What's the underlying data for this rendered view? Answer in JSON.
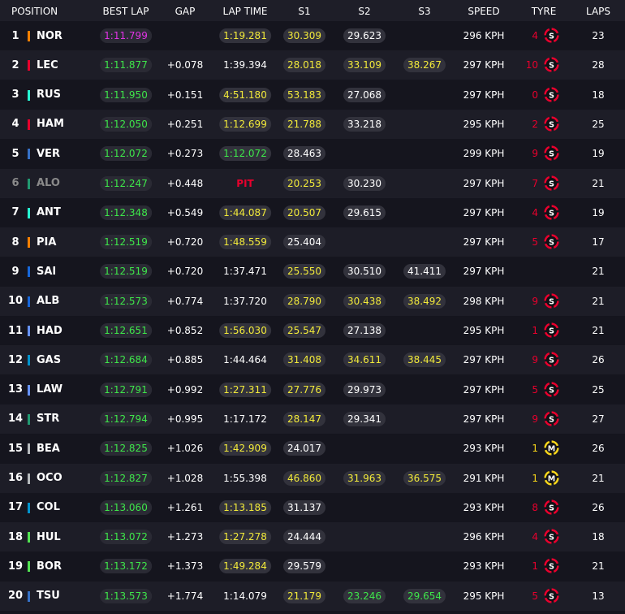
{
  "header": {
    "position": "POSITION",
    "best_lap": "BEST LAP",
    "gap": "GAP",
    "lap_time": "LAP TIME",
    "s1": "S1",
    "s2": "S2",
    "s3": "S3",
    "speed": "SPEED",
    "tyre": "TYRE",
    "laps": "LAPS"
  },
  "colors": {
    "purple": "#e233e6",
    "green": "#3ee64a",
    "yellow": "#f2ea3a",
    "white": "#ffffff",
    "red": "#e8002d",
    "soft": "#e8002d",
    "medium": "#f5d41a"
  },
  "rows": [
    {
      "pos": "1",
      "code": "NOR",
      "team": "#ff8000",
      "best": "1:11.799",
      "best_color": "purple",
      "gap": "",
      "lap": "1:19.281",
      "lap_color": "yellow",
      "s1": "30.309",
      "s1_color": "yellow",
      "s2": "29.623",
      "s2_color": "white",
      "s3": "",
      "s3_color": "white",
      "speed": "296 KPH",
      "tyre_age": "4",
      "tyre": "S",
      "laps": "23",
      "dim": false
    },
    {
      "pos": "2",
      "code": "LEC",
      "team": "#e8002d",
      "best": "1:11.877",
      "best_color": "green",
      "gap": "+0.078",
      "lap": "1:39.394",
      "lap_color": "white",
      "s1": "28.018",
      "s1_color": "yellow",
      "s2": "33.109",
      "s2_color": "yellow",
      "s3": "38.267",
      "s3_color": "yellow",
      "speed": "297 KPH",
      "tyre_age": "10",
      "tyre": "S",
      "laps": "28",
      "dim": false
    },
    {
      "pos": "3",
      "code": "RUS",
      "team": "#27f4d2",
      "best": "1:11.950",
      "best_color": "green",
      "gap": "+0.151",
      "lap": "4:51.180",
      "lap_color": "yellow",
      "s1": "53.183",
      "s1_color": "yellow",
      "s2": "27.068",
      "s2_color": "white",
      "s3": "",
      "s3_color": "white",
      "speed": "297 KPH",
      "tyre_age": "0",
      "tyre": "S",
      "laps": "18",
      "dim": false
    },
    {
      "pos": "4",
      "code": "HAM",
      "team": "#e8002d",
      "best": "1:12.050",
      "best_color": "green",
      "gap": "+0.251",
      "lap": "1:12.699",
      "lap_color": "yellow",
      "s1": "21.788",
      "s1_color": "yellow",
      "s2": "33.218",
      "s2_color": "white",
      "s3": "",
      "s3_color": "white",
      "speed": "295 KPH",
      "tyre_age": "2",
      "tyre": "S",
      "laps": "25",
      "dim": false
    },
    {
      "pos": "5",
      "code": "VER",
      "team": "#3671c6",
      "best": "1:12.072",
      "best_color": "green",
      "gap": "+0.273",
      "lap": "1:12.072",
      "lap_color": "green",
      "s1": "28.463",
      "s1_color": "white",
      "s2": "",
      "s2_color": "white",
      "s3": "",
      "s3_color": "white",
      "speed": "299 KPH",
      "tyre_age": "9",
      "tyre": "S",
      "laps": "19",
      "dim": false
    },
    {
      "pos": "6",
      "code": "ALO",
      "team": "#229971",
      "best": "1:12.247",
      "best_color": "green",
      "gap": "+0.448",
      "lap": "PIT",
      "lap_color": "red",
      "s1": "20.253",
      "s1_color": "yellow",
      "s2": "30.230",
      "s2_color": "white",
      "s3": "",
      "s3_color": "white",
      "speed": "297 KPH",
      "tyre_age": "7",
      "tyre": "S",
      "laps": "21",
      "dim": true
    },
    {
      "pos": "7",
      "code": "ANT",
      "team": "#27f4d2",
      "best": "1:12.348",
      "best_color": "green",
      "gap": "+0.549",
      "lap": "1:44.087",
      "lap_color": "yellow",
      "s1": "20.507",
      "s1_color": "yellow",
      "s2": "29.615",
      "s2_color": "white",
      "s3": "",
      "s3_color": "white",
      "speed": "297 KPH",
      "tyre_age": "4",
      "tyre": "S",
      "laps": "19",
      "dim": false
    },
    {
      "pos": "8",
      "code": "PIA",
      "team": "#ff8000",
      "best": "1:12.519",
      "best_color": "green",
      "gap": "+0.720",
      "lap": "1:48.559",
      "lap_color": "yellow",
      "s1": "25.404",
      "s1_color": "white",
      "s2": "",
      "s2_color": "white",
      "s3": "",
      "s3_color": "white",
      "speed": "297 KPH",
      "tyre_age": "5",
      "tyre": "S",
      "laps": "17",
      "dim": false
    },
    {
      "pos": "9",
      "code": "SAI",
      "team": "#1868db",
      "best": "1:12.519",
      "best_color": "green",
      "gap": "+0.720",
      "lap": "1:37.471",
      "lap_color": "white",
      "s1": "25.550",
      "s1_color": "yellow",
      "s2": "30.510",
      "s2_color": "white",
      "s3": "41.411",
      "s3_color": "white",
      "speed": "297 KPH",
      "tyre_age": "",
      "tyre": "",
      "laps": "21",
      "dim": false
    },
    {
      "pos": "10",
      "code": "ALB",
      "team": "#1868db",
      "best": "1:12.573",
      "best_color": "green",
      "gap": "+0.774",
      "lap": "1:37.720",
      "lap_color": "white",
      "s1": "28.790",
      "s1_color": "yellow",
      "s2": "30.438",
      "s2_color": "yellow",
      "s3": "38.492",
      "s3_color": "yellow",
      "speed": "298 KPH",
      "tyre_age": "9",
      "tyre": "S",
      "laps": "21",
      "dim": false
    },
    {
      "pos": "11",
      "code": "HAD",
      "team": "#6692ff",
      "best": "1:12.651",
      "best_color": "green",
      "gap": "+0.852",
      "lap": "1:56.030",
      "lap_color": "yellow",
      "s1": "25.547",
      "s1_color": "yellow",
      "s2": "27.138",
      "s2_color": "white",
      "s3": "",
      "s3_color": "white",
      "speed": "295 KPH",
      "tyre_age": "1",
      "tyre": "S",
      "laps": "21",
      "dim": false
    },
    {
      "pos": "12",
      "code": "GAS",
      "team": "#0093cc",
      "best": "1:12.684",
      "best_color": "green",
      "gap": "+0.885",
      "lap": "1:44.464",
      "lap_color": "white",
      "s1": "31.408",
      "s1_color": "yellow",
      "s2": "34.611",
      "s2_color": "yellow",
      "s3": "38.445",
      "s3_color": "yellow",
      "speed": "297 KPH",
      "tyre_age": "9",
      "tyre": "S",
      "laps": "26",
      "dim": false
    },
    {
      "pos": "13",
      "code": "LAW",
      "team": "#6692ff",
      "best": "1:12.791",
      "best_color": "green",
      "gap": "+0.992",
      "lap": "1:27.311",
      "lap_color": "yellow",
      "s1": "27.776",
      "s1_color": "yellow",
      "s2": "29.973",
      "s2_color": "white",
      "s3": "",
      "s3_color": "white",
      "speed": "297 KPH",
      "tyre_age": "5",
      "tyre": "S",
      "laps": "25",
      "dim": false
    },
    {
      "pos": "14",
      "code": "STR",
      "team": "#229971",
      "best": "1:12.794",
      "best_color": "green",
      "gap": "+0.995",
      "lap": "1:17.172",
      "lap_color": "white",
      "s1": "28.147",
      "s1_color": "yellow",
      "s2": "29.341",
      "s2_color": "white",
      "s3": "",
      "s3_color": "white",
      "speed": "297 KPH",
      "tyre_age": "9",
      "tyre": "S",
      "laps": "27",
      "dim": false
    },
    {
      "pos": "15",
      "code": "BEA",
      "team": "#b6babd",
      "best": "1:12.825",
      "best_color": "green",
      "gap": "+1.026",
      "lap": "1:42.909",
      "lap_color": "yellow",
      "s1": "24.017",
      "s1_color": "white",
      "s2": "",
      "s2_color": "white",
      "s3": "",
      "s3_color": "white",
      "speed": "293 KPH",
      "tyre_age": "1",
      "tyre": "M",
      "laps": "26",
      "dim": false
    },
    {
      "pos": "16",
      "code": "OCO",
      "team": "#b6babd",
      "best": "1:12.827",
      "best_color": "green",
      "gap": "+1.028",
      "lap": "1:55.398",
      "lap_color": "white",
      "s1": "46.860",
      "s1_color": "yellow",
      "s2": "31.963",
      "s2_color": "yellow",
      "s3": "36.575",
      "s3_color": "yellow",
      "speed": "291 KPH",
      "tyre_age": "1",
      "tyre": "M",
      "laps": "21",
      "dim": false
    },
    {
      "pos": "17",
      "code": "COL",
      "team": "#0093cc",
      "best": "1:13.060",
      "best_color": "green",
      "gap": "+1.261",
      "lap": "1:13.185",
      "lap_color": "yellow",
      "s1": "31.137",
      "s1_color": "white",
      "s2": "",
      "s2_color": "white",
      "s3": "",
      "s3_color": "white",
      "speed": "293 KPH",
      "tyre_age": "8",
      "tyre": "S",
      "laps": "26",
      "dim": false
    },
    {
      "pos": "18",
      "code": "HUL",
      "team": "#52e252",
      "best": "1:13.072",
      "best_color": "green",
      "gap": "+1.273",
      "lap": "1:27.278",
      "lap_color": "yellow",
      "s1": "24.444",
      "s1_color": "white",
      "s2": "",
      "s2_color": "white",
      "s3": "",
      "s3_color": "white",
      "speed": "296 KPH",
      "tyre_age": "4",
      "tyre": "S",
      "laps": "18",
      "dim": false
    },
    {
      "pos": "19",
      "code": "BOR",
      "team": "#52e252",
      "best": "1:13.172",
      "best_color": "green",
      "gap": "+1.373",
      "lap": "1:49.284",
      "lap_color": "yellow",
      "s1": "29.579",
      "s1_color": "white",
      "s2": "",
      "s2_color": "white",
      "s3": "",
      "s3_color": "white",
      "speed": "293 KPH",
      "tyre_age": "1",
      "tyre": "S",
      "laps": "21",
      "dim": false
    },
    {
      "pos": "20",
      "code": "TSU",
      "team": "#3671c6",
      "best": "1:13.573",
      "best_color": "green",
      "gap": "+1.774",
      "lap": "1:14.079",
      "lap_color": "white",
      "s1": "21.179",
      "s1_color": "yellow",
      "s2": "23.246",
      "s2_color": "green",
      "s3": "29.654",
      "s3_color": "green",
      "speed": "295 KPH",
      "tyre_age": "5",
      "tyre": "S",
      "laps": "13",
      "dim": false
    }
  ]
}
